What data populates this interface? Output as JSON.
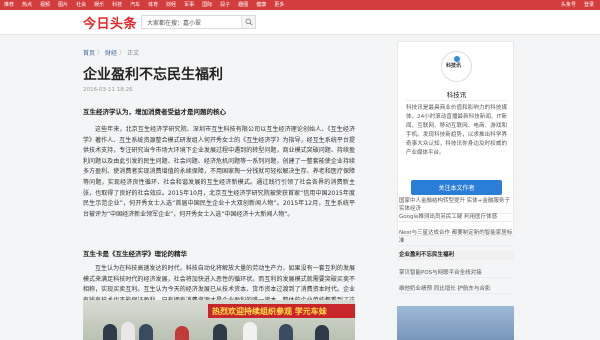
{
  "topnav": {
    "items": [
      "推荐",
      "热点",
      "视频",
      "图片",
      "社会",
      "娱乐",
      "科技",
      "汽车",
      "体育",
      "财经",
      "军事",
      "国际",
      "段子",
      "趣图",
      "健康",
      "更多"
    ],
    "right": [
      "头条号",
      "登录"
    ]
  },
  "header": {
    "logo": "今日头条",
    "search_value": "大家都在搜：嘉小翠"
  },
  "breadcrumb": {
    "home": "首页",
    "section": "财经",
    "current": "正文",
    "sep": "〉"
  },
  "article": {
    "title": "企业盈利不忘民生福利",
    "date": "2016-03-11 18:26",
    "subhead1": "互生经济学认为，增加消费者受益才是问题的核心",
    "para1": "这些年来，北京互生经济学研究院、深圳市互生科技有限公司以互生经济理论创始人、《互生经济学》著作人、互生系统资源整合模式研发组人何开秀女士的《互生经济学》为指导，经互生系统平台提供技术支持，专注研究当今市场大环境下企业发展过程中遇到的转型问题，商业模式突破问题、持续盈利问题以及由此引发的民生问题、社会问题、经济危机问题等一系列问题，创建了一整套能使企业持续多方盈利、使消费者实现消费增值的永续保障，不用国家掏一分钱就可轻松解决生存、养老和医疗保障等问题，实现经济良性循环、社会和谐发展的互生经济新模式。通过践行引领了社会各界的消费新主张，也取得了良好的社会效应。2015年10月，北京互生经济学研究院被荣获首家“信用中国2015年度民生示范企业”，何开秀女士入选“首届中国民生企业十大双创新闻人物”。2015年12月，互生系统平台被评为“中国经济新业领军企业”，何开秀女士入选“中国经济十大新闻人物”。",
    "subhead2": "互生卡是《互生经济学》理论的精华",
    "para2": "互生认为在科技高速发达的时代，科技自动化将解放大量的劳动生产力，如果没有一套互利的发展模式来满足科技时代的经济发展，社会将加快进入恶性的循环状。而互利的发展模式就需要突破买卖不相称，实现买卖互利。互生认为今天的经济发展已从技术资本、货币资本过渡到了消费资本时代。企业有钱有技术也不能保证盈利，只有拥有消费资源才是企业盈利的唯一资本。整体的企业单纯都看到了这个问题，都在争取绑定消费者的消费通道，甚至于大打价格竞争战，以省钱来促进消费。互生认为企业的过分价格竞争并不能拉动消费，反而会破坏产品价值链，导致企业生存危机，就业危机。再加上一部分消费者的收入不能满足自身的消费需求，"
  },
  "card": {
    "avatar_label": "科技讯",
    "name": "科技讯",
    "desc": "科技讯是最具商业价值和影响力的科技媒体，24小时滚动直播最新科技新闻、IT新闻、互联网、移动互联网、电商、游戏和手机。发现科技新趋势，以求推出科学界奇事大众认知，科技讯你身边及时权威的产业媒体平台。",
    "follow": "关注本文作者"
  },
  "related": [
    "国家中人金融结构转型提升 实体+金融服务于实体经济",
    "Google推测出员另民工疑 利用医疗体感",
    "Nest与三星达成合作 都要制定新的智能家居标准",
    "企业盈利不忘民生福利",
    "掌贝智能POS与网联平台全线对接",
    "维他奶业绩预 同比增长 护航东与合影"
  ],
  "photo": {
    "banner": "热烈欢迎持续组织参观 学元车妹"
  },
  "colors": {
    "brand_red": "#d43d3d",
    "link_blue": "#406599",
    "follow_blue": "#2b7ed8"
  }
}
